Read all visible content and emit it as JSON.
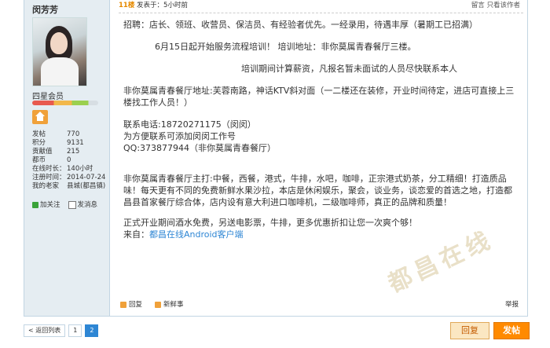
{
  "user": {
    "name": "闵芳芳",
    "rank": "四星会员",
    "stats": [
      {
        "k": "发帖",
        "v": "770"
      },
      {
        "k": "积分",
        "v": "9131"
      },
      {
        "k": "贡献值",
        "v": "215"
      },
      {
        "k": "都币",
        "v": "0"
      },
      {
        "k": "在线时长：",
        "v": "140小时"
      },
      {
        "k": "注册时间：",
        "v": "2014-07-24"
      },
      {
        "k": "我的老家",
        "v": "县城(都昌镇)"
      }
    ],
    "add_friend": "加关注",
    "send_msg": "发消息"
  },
  "post": {
    "floor": "11楼",
    "time": "发表于：5小时前",
    "top_actions": "留言 只看该作者",
    "lines": [
      "招聘：店长、领班、收营员、保洁员、有经验者优先。一经录用，待遇丰厚（暑期工已招满）",
      "6月15日起开始服务流程培训！    培训地址：非你莫属青春餐厅三楼。",
      "培训期间计算薪资，凡报名暂未面试的人员尽快联系本人",
      "非你莫属青春餐厅地址:芙蓉南路，神话KTV斜对面（一二楼还在装修，开业时间待定，进店可直接上三楼找工作人员！）",
      "联系电话:18720271175（闵闵）",
      "为方便联系可添加闵闵工作号",
      "QQ:373877944（非你莫属青春餐厅）",
      "非你莫属青春餐厅主打:中餐，西餐，港式，牛排，水吧，咖啡，正宗港式奶茶，分工精细！打造质品味！每天更有不同的免费新鲜水果沙拉，本店是休闲娱乐，聚会，谈业务，谈恋爱的首选之地，打造都昌县首家餐厅综合体，店内设有意大利进口咖啡机，二级咖啡师，真正的品牌和质量！",
      "正式开业期间酒水免费，另送电影票，牛排，更多优惠折扣让您一次爽个够！",
      "来自：",
      "都昌在线Android客户端"
    ],
    "reply": "回复",
    "fresh": "新鲜事",
    "report": "举报"
  },
  "pager": {
    "back": "< 返回列表",
    "p1": "1",
    "p2": "2"
  },
  "buttons": {
    "reply": "回复",
    "post": "发帖"
  },
  "watermark": "都昌在线",
  "colors": {
    "accent": "#ff8a00",
    "link": "#2e86d4",
    "floor": "#e68a00",
    "sidebar": "#e5edf2"
  }
}
